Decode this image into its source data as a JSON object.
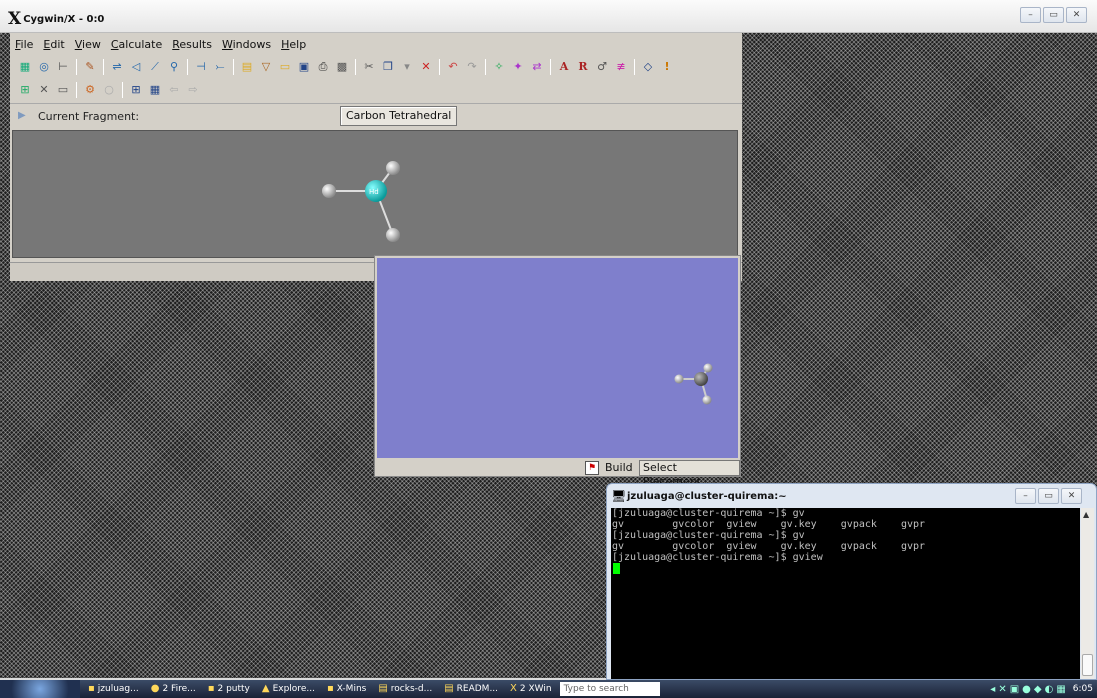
{
  "cygwin": {
    "title": "Cygwin/X - 0:0",
    "buttons": [
      "minimize",
      "maximize",
      "close"
    ]
  },
  "gaussview": {
    "menu": [
      "File",
      "Edit",
      "View",
      "Calculate",
      "Results",
      "Windows",
      "Help"
    ],
    "menu_underline": [
      "F",
      "E",
      "V",
      "C",
      "R",
      "W",
      "H"
    ],
    "fragment_label": "Current Fragment:",
    "fragment_value": "Carbon Tetrahedral",
    "center_atom_label": "Hd",
    "view_mode": "Build",
    "view_placement": "Select Placement"
  },
  "putty": {
    "title": "jzuluaga@cluster-quirema:~",
    "lines": [
      "[jzuluaga@cluster-quirema ~]$ gv",
      "gv        gvcolor  gview    gv.key    gvpack    gvpr",
      "[jzuluaga@cluster-quirema ~]$ gv",
      "gv        gvcolor  gview    gv.key    gvpack    gvpr",
      "[jzuluaga@cluster-quirema ~]$ gview"
    ]
  },
  "taskbar": {
    "tasks": [
      "jzuluag...",
      "2 Fire...",
      "2 putty",
      "Explore...",
      "X-Mins",
      "rocks-d...",
      "READM...",
      "2 XWin"
    ],
    "search_placeholder": "Type to search",
    "clock": "6:05"
  },
  "colors": {
    "desktop": "#1e1e1e",
    "builder_bg": "#777777",
    "view_bg": "#7f7fcc",
    "carbon_atom": "#1fc6c6",
    "cursor": "#00ff00"
  }
}
